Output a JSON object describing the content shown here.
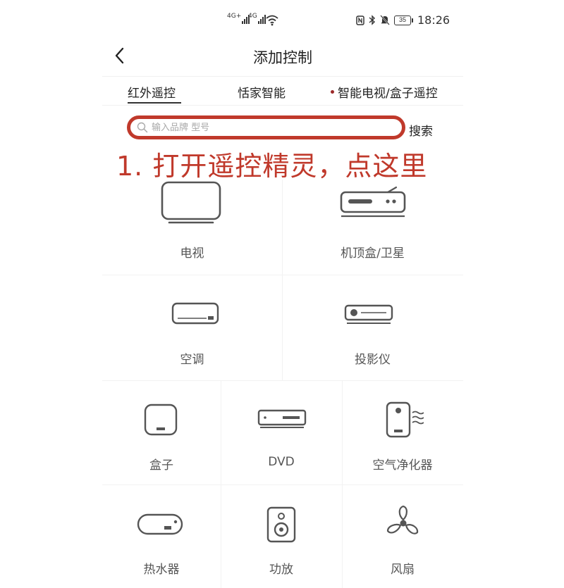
{
  "status_bar": {
    "signal_1": "4G+",
    "signal_2": "4G",
    "time": "18:26",
    "battery": "35"
  },
  "header": {
    "title": "添加控制"
  },
  "tabs": [
    {
      "label": "红外遥控",
      "active": true
    },
    {
      "label": "恬家智能",
      "active": false
    },
    {
      "label": "智能电视/盒子遥控",
      "active": false,
      "dot": true
    }
  ],
  "search": {
    "placeholder": "输入品牌 型号",
    "button_label": "搜索"
  },
  "annotation": "1. 打开遥控精灵，点这里",
  "devices": [
    {
      "label": "电视",
      "icon": "tv-icon"
    },
    {
      "label": "机顶盒/卫星",
      "icon": "set-top-box-icon"
    },
    {
      "label": "空调",
      "icon": "air-conditioner-icon"
    },
    {
      "label": "投影仪",
      "icon": "projector-icon"
    },
    {
      "label": "盒子",
      "icon": "box-icon"
    },
    {
      "label": "DVD",
      "icon": "dvd-icon"
    },
    {
      "label": "空气净化器",
      "icon": "air-purifier-icon"
    },
    {
      "label": "热水器",
      "icon": "water-heater-icon"
    },
    {
      "label": "功放",
      "icon": "amplifier-icon"
    },
    {
      "label": "风扇",
      "icon": "fan-icon"
    }
  ],
  "colors": {
    "accent_red": "#c0392b",
    "tab_dot": "#9b2a2a",
    "icon_stroke": "#555555"
  }
}
